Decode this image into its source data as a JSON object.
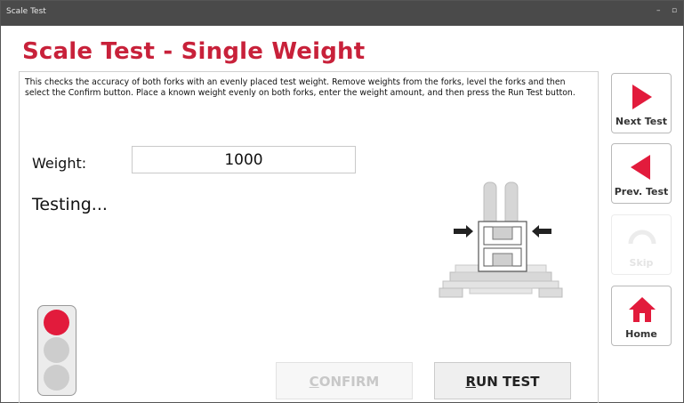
{
  "window": {
    "title": "Scale Test",
    "minimize_glyph": "–",
    "maximize_glyph": "▫"
  },
  "page": {
    "title": "Scale Test - Single Weight",
    "description": "This checks the accuracy of both forks with an evenly placed test weight. Remove weights from the forks, level the forks and then select the Confirm button. Place a known weight evenly on both forks, enter the weight amount, and then press the Run Test button.",
    "weight_label": "Weight:",
    "weight_value": "1000",
    "status": "Testing...",
    "confirm_label": "CONFIRM",
    "confirm_label_first": "C",
    "confirm_label_rest": "ONFIRM",
    "run_label_first": "R",
    "run_label_rest": "UN TEST",
    "confirm_enabled": false
  },
  "indicator": {
    "active_light": "red",
    "colors": {
      "red": "#e21b3c",
      "off": "#cdcdcd"
    }
  },
  "sidebar": {
    "next": {
      "label": "Next Test",
      "icon": "play-right-icon"
    },
    "prev": {
      "label": "Prev. Test",
      "icon": "play-left-icon"
    },
    "skip": {
      "label": "Skip",
      "icon": "skip-icon",
      "enabled": false
    },
    "home": {
      "label": "Home",
      "icon": "home-icon"
    }
  },
  "colors": {
    "accent": "#c8213a",
    "icon_red": "#e21b3c"
  }
}
